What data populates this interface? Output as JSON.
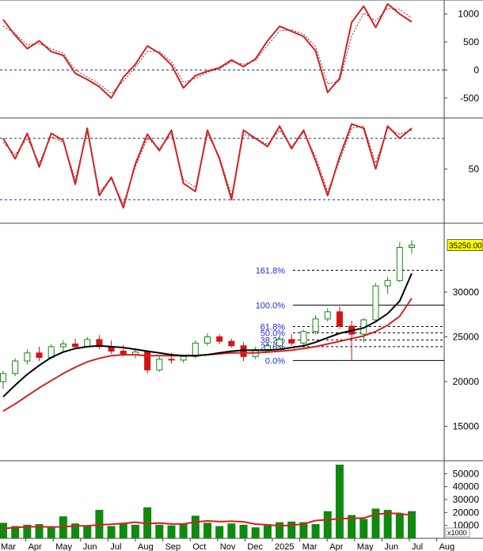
{
  "colors": {
    "background": "#ffffff",
    "up_candle": "#118a11",
    "down_candle": "#d21414",
    "ma_fast": "#000000",
    "ma_slow": "#d42020",
    "volume": "#0f8a0f",
    "volume_ma": "#d42020",
    "indicator": "#d42020",
    "indicator_signal": "#7a2a2a",
    "fib_text": "#1f2bd6",
    "fib_line": "#000000",
    "ref_line": "#1a2a9c",
    "price_tag": "#ffff00"
  },
  "chart_data": [
    {
      "type": "line",
      "panel": "momentum oscillator",
      "y_ticks": [
        "1000",
        "500",
        "0",
        "-500"
      ],
      "ylim": [
        -800,
        1250
      ],
      "ref_lines": [
        0
      ],
      "series": [
        {
          "values": [
            900,
            620,
            380,
            520,
            330,
            260,
            -60,
            -170,
            -300,
            -500,
            -130,
            100,
            430,
            300,
            90,
            -320,
            -100,
            -20,
            40,
            180,
            60,
            200,
            520,
            780,
            690,
            600,
            340,
            -400,
            -150,
            850,
            1140,
            760,
            1180,
            1000,
            860
          ]
        },
        {
          "values": [
            780,
            650,
            450,
            470,
            380,
            300,
            0,
            -120,
            -250,
            -420,
            -200,
            50,
            330,
            330,
            150,
            -220,
            -150,
            -40,
            20,
            150,
            100,
            170,
            440,
            700,
            720,
            640,
            420,
            -250,
            -200,
            600,
            1020,
            880,
            1100,
            1080,
            930
          ]
        }
      ]
    },
    {
      "type": "line",
      "panel": "stochastic oscillator",
      "y_ticks": [
        "50"
      ],
      "ylim": [
        0,
        100
      ],
      "ref_lines": [
        20,
        80
      ],
      "series": [
        {
          "values": [
            80,
            60,
            85,
            52,
            85,
            78,
            35,
            90,
            24,
            42,
            12,
            55,
            84,
            68,
            88,
            36,
            28,
            88,
            60,
            20,
            88,
            80,
            72,
            92,
            70,
            88,
            58,
            24,
            62,
            94,
            90,
            50,
            92,
            80,
            90
          ]
        },
        {
          "values": [
            76,
            64,
            80,
            56,
            82,
            76,
            40,
            86,
            28,
            40,
            16,
            52,
            80,
            70,
            84,
            40,
            32,
            84,
            62,
            24,
            84,
            80,
            74,
            88,
            72,
            86,
            62,
            28,
            58,
            90,
            92,
            56,
            90,
            84,
            88
          ]
        }
      ]
    },
    {
      "type": "candlestick",
      "panel": "price",
      "y_ticks": [
        "30000",
        "25000",
        "20000",
        "15000"
      ],
      "ylim": [
        11500,
        37700
      ],
      "last_price_label": "35250.00",
      "candles": [
        {
          "o": 20000,
          "h": 21200,
          "l": 19200,
          "c": 20900
        },
        {
          "o": 20900,
          "h": 22600,
          "l": 20600,
          "c": 22300
        },
        {
          "o": 22300,
          "h": 23600,
          "l": 21900,
          "c": 23200
        },
        {
          "o": 23200,
          "h": 23900,
          "l": 22300,
          "c": 22700
        },
        {
          "o": 22700,
          "h": 24200,
          "l": 22500,
          "c": 23900
        },
        {
          "o": 23900,
          "h": 24600,
          "l": 23300,
          "c": 24200
        },
        {
          "o": 24200,
          "h": 24800,
          "l": 23600,
          "c": 23900
        },
        {
          "o": 23900,
          "h": 25000,
          "l": 23800,
          "c": 24700
        },
        {
          "o": 24700,
          "h": 25200,
          "l": 23600,
          "c": 23900
        },
        {
          "o": 23900,
          "h": 24600,
          "l": 23100,
          "c": 23400
        },
        {
          "o": 23400,
          "h": 24100,
          "l": 22800,
          "c": 23000
        },
        {
          "o": 23000,
          "h": 23700,
          "l": 22600,
          "c": 23300
        },
        {
          "o": 23300,
          "h": 23500,
          "l": 20900,
          "c": 21300
        },
        {
          "o": 21300,
          "h": 22800,
          "l": 21100,
          "c": 22500
        },
        {
          "o": 22500,
          "h": 23200,
          "l": 22000,
          "c": 22400
        },
        {
          "o": 22400,
          "h": 23000,
          "l": 22100,
          "c": 22800
        },
        {
          "o": 22800,
          "h": 24600,
          "l": 22600,
          "c": 24300
        },
        {
          "o": 24300,
          "h": 25400,
          "l": 24000,
          "c": 25000
        },
        {
          "o": 25000,
          "h": 25300,
          "l": 24200,
          "c": 24500
        },
        {
          "o": 24500,
          "h": 24800,
          "l": 23800,
          "c": 24000
        },
        {
          "o": 24000,
          "h": 24400,
          "l": 22300,
          "c": 22800
        },
        {
          "o": 22800,
          "h": 23900,
          "l": 22500,
          "c": 23600
        },
        {
          "o": 23600,
          "h": 24300,
          "l": 23300,
          "c": 24000
        },
        {
          "o": 24000,
          "h": 25100,
          "l": 23800,
          "c": 24700
        },
        {
          "o": 24700,
          "h": 25300,
          "l": 24000,
          "c": 24300
        },
        {
          "o": 24300,
          "h": 25800,
          "l": 24000,
          "c": 25600
        },
        {
          "o": 25600,
          "h": 27400,
          "l": 25300,
          "c": 27000
        },
        {
          "o": 27000,
          "h": 28200,
          "l": 26700,
          "c": 27800
        },
        {
          "o": 27800,
          "h": 28400,
          "l": 25900,
          "c": 26200
        },
        {
          "o": 26200,
          "h": 26800,
          "l": 22400,
          "c": 25300
        },
        {
          "o": 25300,
          "h": 27100,
          "l": 24400,
          "c": 26900
        },
        {
          "o": 26900,
          "h": 31000,
          "l": 26700,
          "c": 30700
        },
        {
          "o": 30700,
          "h": 31700,
          "l": 29800,
          "c": 31300
        },
        {
          "o": 31300,
          "h": 35600,
          "l": 31100,
          "c": 35000
        },
        {
          "o": 35000,
          "h": 35800,
          "l": 34300,
          "c": 35250
        }
      ],
      "ma_fast": [
        18300,
        19600,
        20800,
        21800,
        22700,
        23300,
        23700,
        23900,
        24000,
        23900,
        23800,
        23600,
        23400,
        23200,
        23000,
        22900,
        22900,
        23000,
        23200,
        23400,
        23500,
        23500,
        23500,
        23600,
        23800,
        24000,
        24400,
        24900,
        25400,
        25700,
        26000,
        26700,
        27600,
        29000,
        32100
      ],
      "ma_slow": [
        16700,
        17500,
        18400,
        19300,
        20100,
        20900,
        21600,
        22200,
        22600,
        22900,
        23000,
        23000,
        22900,
        22900,
        22900,
        22900,
        22900,
        23000,
        23100,
        23200,
        23200,
        23200,
        23300,
        23400,
        23500,
        23700,
        23900,
        24200,
        24500,
        24800,
        25100,
        25600,
        26300,
        27300,
        29300
      ],
      "fibonacci": [
        {
          "label": "161.8%",
          "value": 32450
        },
        {
          "label": "100.0%",
          "value": 28550
        },
        {
          "label": "61.8%",
          "value": 26150
        },
        {
          "label": "50.0%",
          "value": 25450
        },
        {
          "label": "38.2%",
          "value": 24650
        },
        {
          "label": "23.6%",
          "value": 23900
        },
        {
          "label": "0.0%",
          "value": 22350
        }
      ]
    },
    {
      "type": "bar",
      "panel": "volume",
      "y_ticks": [
        "50000",
        "40000",
        "30000",
        "20000",
        "10000"
      ],
      "ylim": [
        0,
        60000
      ],
      "unit_label": "x1000",
      "values": [
        12000,
        9500,
        10500,
        11000,
        8500,
        17000,
        11500,
        10000,
        22000,
        9500,
        12000,
        10500,
        24000,
        10500,
        10000,
        11500,
        17500,
        12000,
        9500,
        11500,
        10500,
        8500,
        10000,
        12500,
        13000,
        12500,
        11000,
        21000,
        57000,
        18000,
        15000,
        23000,
        22000,
        19000,
        21000
      ],
      "ma_values": [
        7600,
        8300,
        8900,
        9000,
        8800,
        8900,
        9700,
        9700,
        10500,
        10900,
        11500,
        12500,
        11300,
        11900,
        11100,
        11100,
        12700,
        13500,
        12900,
        13200,
        12800,
        11000,
        10500,
        9700,
        10100,
        11100,
        13800,
        14300,
        15300,
        15500,
        15700,
        18600,
        19300,
        19300,
        17600
      ]
    }
  ],
  "x_axis": {
    "months": [
      "Mar",
      "Apr",
      "May",
      "Jun",
      "Jul",
      "Aug",
      "Sep",
      "Oct",
      "Nov",
      "Dec",
      "2025",
      "Mar",
      "Apr",
      "May",
      "Jun",
      "Jul",
      "Aug"
    ]
  }
}
